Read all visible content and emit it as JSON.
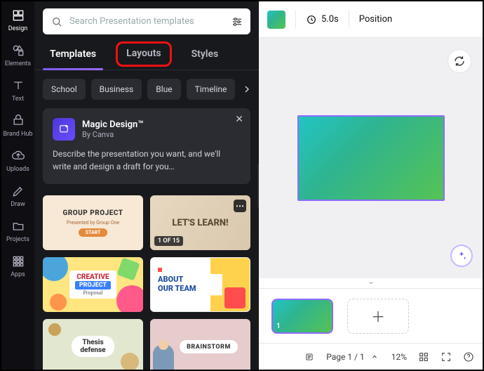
{
  "rail": {
    "items": [
      {
        "label": "Design"
      },
      {
        "label": "Elements"
      },
      {
        "label": "Text"
      },
      {
        "label": "Brand Hub"
      },
      {
        "label": "Uploads"
      },
      {
        "label": "Draw"
      },
      {
        "label": "Projects"
      },
      {
        "label": "Apps"
      }
    ]
  },
  "search": {
    "placeholder": "Search Presentation templates"
  },
  "tabs": {
    "templates": "Templates",
    "layouts": "Layouts",
    "styles": "Styles"
  },
  "chips": [
    "School",
    "Business",
    "Blue",
    "Timeline"
  ],
  "magic": {
    "title": "Magic Design™",
    "sub": "By Canva",
    "desc": "Describe the presentation you want, and we'll write and design a draft for you…"
  },
  "thumbs": {
    "t1": "GROUP PROJECT",
    "t2": "LET'S LEARN!",
    "t2_badge": "1 OF 15",
    "t3a": "CREATIVE",
    "t3b": "PROJECT",
    "t4a": "ABOUT",
    "t4b": "OUR TEAM",
    "t5a": "Thesis",
    "t5b": "defense",
    "t6": "BRAINSTORM"
  },
  "toolbar": {
    "duration": "5.0s",
    "position": "Position"
  },
  "footer": {
    "page_label": "Page 1 / 1",
    "zoom": "12%"
  },
  "page_thumb_num": "1"
}
